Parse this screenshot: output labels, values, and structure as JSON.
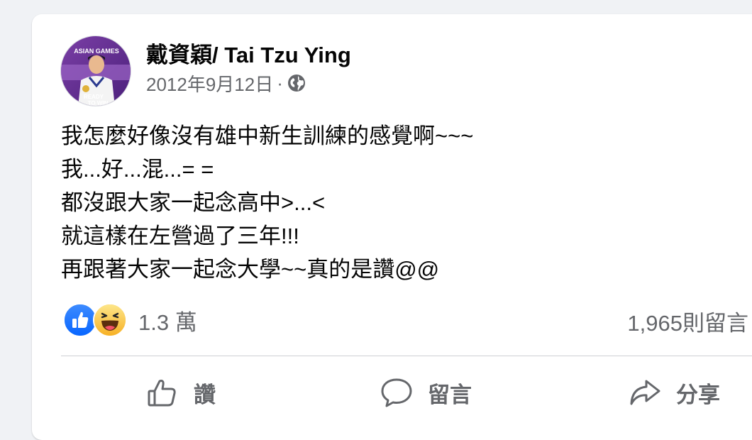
{
  "post": {
    "author": "戴資穎/ Tai Tzu Ying",
    "date": "2012年9月12日",
    "separator": "·",
    "audience_icon": "globe-icon",
    "avatar_text_top": "ASIAN GAMES",
    "avatar_text_bottom_1": "READY",
    "avatar_text_bottom_2": "TO WIN",
    "lines": [
      "我怎麼好像沒有雄中新生訓練的感覺啊~~~",
      "我...好...混...= =",
      "都沒跟大家一起念高中>...<",
      "就這樣在左營過了三年!!!",
      "再跟著大家一起念大學~~真的是讚@@"
    ]
  },
  "stats": {
    "reaction_icons": [
      "like-reaction-icon",
      "haha-reaction-icon"
    ],
    "reaction_count": "1.3 萬",
    "comment_count": "1,965則留言"
  },
  "actions": {
    "like": "讚",
    "comment": "留言",
    "share": "分享"
  },
  "colors": {
    "background": "#f0f2f5",
    "card": "#ffffff",
    "primary_text": "#050505",
    "secondary_text": "#65676b",
    "like_blue": "#1877f2",
    "haha_yellow": "#f7b125"
  }
}
